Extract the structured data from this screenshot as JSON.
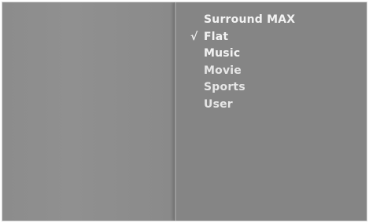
{
  "menu": {
    "items": [
      {
        "label": "Surround MAX",
        "checked": false
      },
      {
        "label": "Flat",
        "checked": true
      },
      {
        "label": "Music",
        "checked": false
      },
      {
        "label": "Movie",
        "checked": false
      },
      {
        "label": "Sports",
        "checked": false
      },
      {
        "label": "User",
        "checked": false
      }
    ],
    "check_glyph": "√"
  }
}
